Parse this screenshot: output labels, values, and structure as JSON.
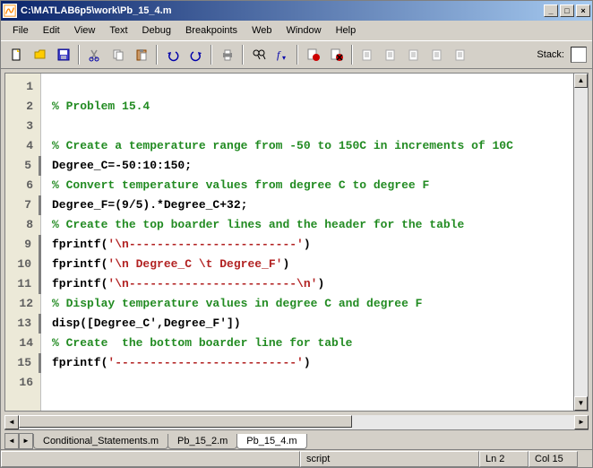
{
  "window": {
    "title": "C:\\MATLAB6p5\\work\\Pb_15_4.m"
  },
  "menu": {
    "items": [
      "File",
      "Edit",
      "View",
      "Text",
      "Debug",
      "Breakpoints",
      "Web",
      "Window",
      "Help"
    ]
  },
  "toolbar": {
    "stack_label": "Stack:"
  },
  "code": {
    "lines": [
      {
        "n": 1,
        "dash": false,
        "segs": []
      },
      {
        "n": 2,
        "dash": false,
        "segs": [
          {
            "cls": "c-comment",
            "t": "% Problem 15.4"
          }
        ]
      },
      {
        "n": 3,
        "dash": false,
        "segs": []
      },
      {
        "n": 4,
        "dash": false,
        "segs": [
          {
            "cls": "c-comment",
            "t": "% Create a temperature range from -50 to 150C in increments of 10C"
          }
        ]
      },
      {
        "n": 5,
        "dash": true,
        "segs": [
          {
            "cls": "c-code",
            "t": "Degree_C=-50:10:150;"
          }
        ]
      },
      {
        "n": 6,
        "dash": false,
        "segs": [
          {
            "cls": "c-comment",
            "t": "% Convert temperature values from degree C to degree F"
          }
        ]
      },
      {
        "n": 7,
        "dash": true,
        "segs": [
          {
            "cls": "c-code",
            "t": "Degree_F=(9/5).*Degree_C+32;"
          }
        ]
      },
      {
        "n": 8,
        "dash": false,
        "segs": [
          {
            "cls": "c-comment",
            "t": "% Create the top boarder lines and the header for the table"
          }
        ]
      },
      {
        "n": 9,
        "dash": true,
        "segs": [
          {
            "cls": "c-code",
            "t": "fprintf("
          },
          {
            "cls": "c-str",
            "t": "'\\n------------------------'"
          },
          {
            "cls": "c-code",
            "t": ")"
          }
        ]
      },
      {
        "n": 10,
        "dash": true,
        "segs": [
          {
            "cls": "c-code",
            "t": "fprintf("
          },
          {
            "cls": "c-str",
            "t": "'\\n Degree_C \\t Degree_F'"
          },
          {
            "cls": "c-code",
            "t": ")"
          }
        ]
      },
      {
        "n": 11,
        "dash": true,
        "segs": [
          {
            "cls": "c-code",
            "t": "fprintf("
          },
          {
            "cls": "c-str",
            "t": "'\\n------------------------\\n'"
          },
          {
            "cls": "c-code",
            "t": ")"
          }
        ]
      },
      {
        "n": 12,
        "dash": false,
        "segs": [
          {
            "cls": "c-comment",
            "t": "% Display temperature values in degree C and degree F"
          }
        ]
      },
      {
        "n": 13,
        "dash": true,
        "segs": [
          {
            "cls": "c-code",
            "t": "disp([Degree_C',Degree_F'])"
          }
        ]
      },
      {
        "n": 14,
        "dash": false,
        "segs": [
          {
            "cls": "c-comment",
            "t": "% Create  the bottom boarder line for table"
          }
        ]
      },
      {
        "n": 15,
        "dash": true,
        "segs": [
          {
            "cls": "c-code",
            "t": "fprintf("
          },
          {
            "cls": "c-str",
            "t": "'--------------------------'"
          },
          {
            "cls": "c-code",
            "t": ")"
          }
        ]
      },
      {
        "n": 16,
        "dash": false,
        "segs": []
      }
    ]
  },
  "tabs": {
    "items": [
      {
        "label": "Conditional_Statements.m",
        "active": false
      },
      {
        "label": "Pb_15_2.m",
        "active": false
      },
      {
        "label": "Pb_15_4.m",
        "active": true
      }
    ]
  },
  "status": {
    "mode": "script",
    "line": "Ln 2",
    "col": "Col 15"
  }
}
